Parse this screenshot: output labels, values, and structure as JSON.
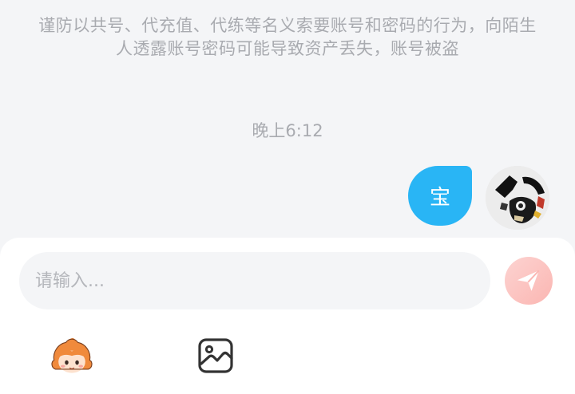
{
  "chat": {
    "security_notice": "谨防以共号、代充值、代练等名义索要账号和密码的行为，向陌生人透露账号密码可能导致资产丢失，账号被盗",
    "timestamp": "晚上6:12",
    "messages": [
      {
        "from": "self",
        "text": "宝"
      }
    ]
  },
  "composer": {
    "placeholder": "请输入...",
    "value": ""
  },
  "icons": {
    "send": "paper-plane-icon",
    "emoji": "sticker-character-icon",
    "image": "image-icon",
    "avatar": "user-avatar"
  },
  "colors": {
    "bubble": "#29b5f5",
    "send_button": "#fbb6b2",
    "background": "#f4f5f7"
  }
}
